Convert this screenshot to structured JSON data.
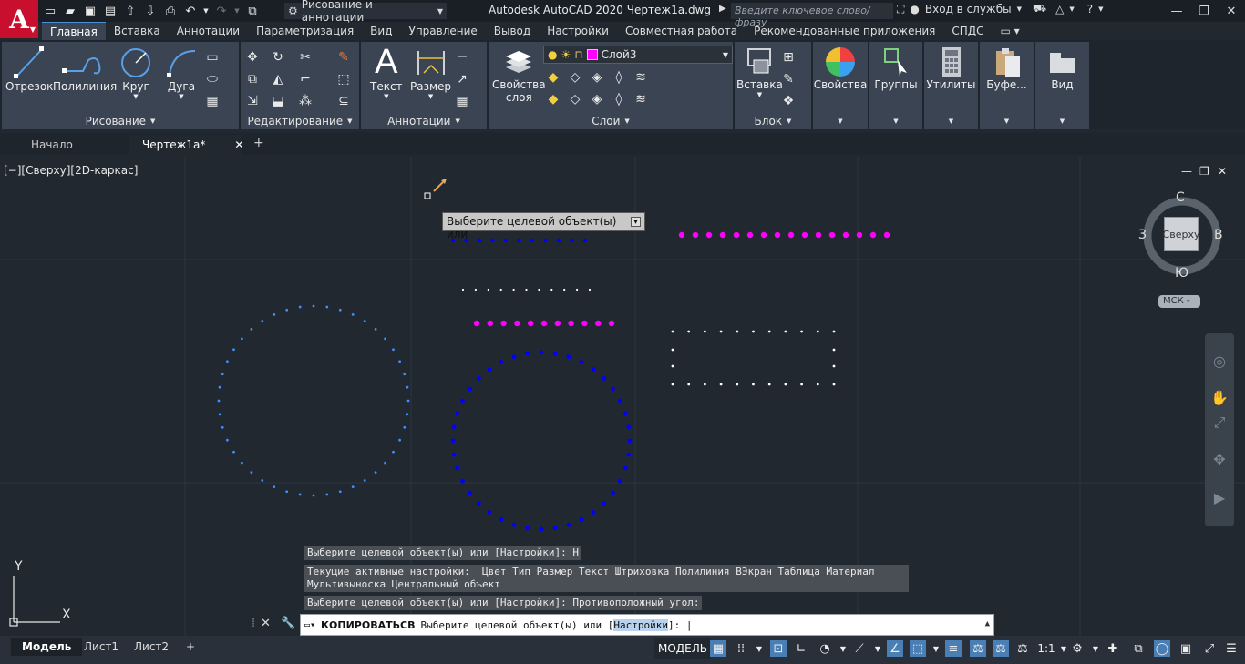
{
  "app": {
    "logo_letter": "A",
    "title": "Autodesk AutoCAD 2020   Чертеж1a.dwg",
    "workspace": "Рисование и аннотации",
    "search_placeholder": "Введите ключевое слово/фразу",
    "signin": "Вход в службы"
  },
  "ribbon_tabs": [
    {
      "label": "Главная",
      "active": true
    },
    {
      "label": "Вставка"
    },
    {
      "label": "Аннотации"
    },
    {
      "label": "Параметризация"
    },
    {
      "label": "Вид"
    },
    {
      "label": "Управление"
    },
    {
      "label": "Вывод"
    },
    {
      "label": "Настройки"
    },
    {
      "label": "Совместная работа"
    },
    {
      "label": "Рекомендованные приложения"
    },
    {
      "label": "СПДС"
    }
  ],
  "ribbon": {
    "draw": {
      "title": "Рисование",
      "line": "Отрезок",
      "polyline": "Полилиния",
      "circle": "Круг",
      "arc": "Дуга"
    },
    "modify": {
      "title": "Редактирование"
    },
    "annotation": {
      "title": "Аннотации",
      "text": "Текст",
      "dimension": "Размер"
    },
    "layers": {
      "title": "Слои",
      "properties_line1": "Свойства",
      "properties_line2": "слоя",
      "current_layer": "Слой3"
    },
    "block": {
      "title": "Блок",
      "insert": "Вставка"
    },
    "properties": "Свойства",
    "groups": "Группы",
    "utilities": "Утилиты",
    "clipboard": "Буфе...",
    "view": "Вид"
  },
  "file_tabs": [
    {
      "label": "Начало"
    },
    {
      "label": "Чертеж1a*",
      "active": true
    }
  ],
  "viewport": {
    "label": "[−][Сверху][2D-каркас]",
    "cube_top": "Сверху",
    "cube_n": "С",
    "cube_s": "Ю",
    "cube_w": "З",
    "cube_e": "В",
    "ucs": "МСК",
    "axis_x": "X",
    "axis_y": "Y"
  },
  "tooltip": "Выберите целевой объект(ы) или",
  "command_history": [
    "Выберите целевой объект(ы) или [Настройки]: Н",
    "Текущие активные настройки:  Цвет Тип Размер Текст Штриховка Полилиния ВЭкран Таблица Материал\nМультивыноска Центральный объект",
    "Выберите целевой объект(ы) или [Настройки]: Противоположный угол:"
  ],
  "command_line": {
    "command": "КОПИРОВАТЬСВ",
    "prompt_before": "Выберите целевой объект(ы) или [",
    "option": "Настройки",
    "prompt_after": "]: "
  },
  "layout_tabs": [
    {
      "label": "Модель",
      "active": true
    },
    {
      "label": "Лист1"
    },
    {
      "label": "Лист2"
    }
  ],
  "status": {
    "model": "МОДЕЛЬ",
    "scale": "1:1"
  },
  "colors": {
    "magenta": "#ff00ff",
    "blue": "#0000ff",
    "light_blue": "#3f8fff",
    "white": "#ffffff",
    "background": "#212830"
  }
}
